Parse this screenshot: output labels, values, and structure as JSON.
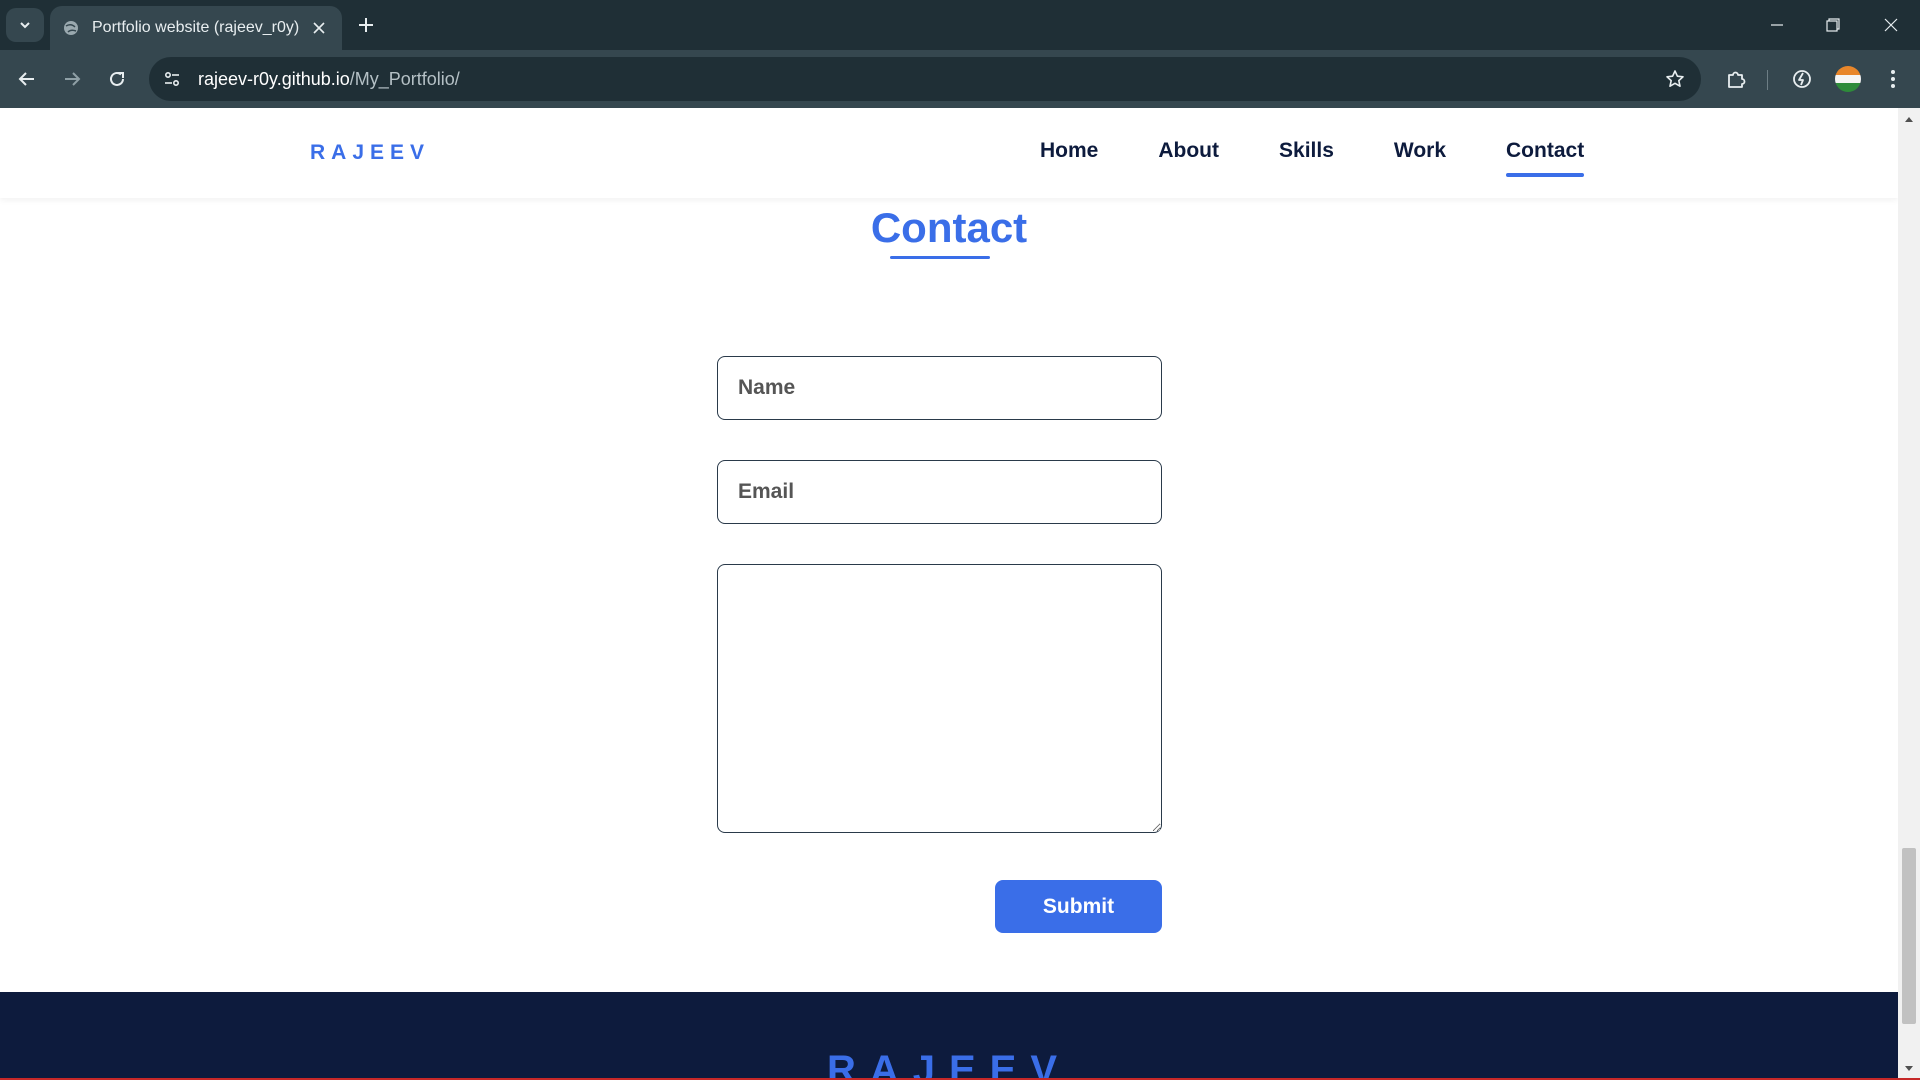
{
  "browser": {
    "tab": {
      "title": "Portfolio website (rajeev_r0y)"
    },
    "address": {
      "host": "rajeev-r0y.github.io",
      "path": "/My_Portfolio/"
    }
  },
  "site": {
    "logo": "RAJEEV",
    "nav": {
      "items": [
        {
          "label": "Home"
        },
        {
          "label": "About"
        },
        {
          "label": "Skills"
        },
        {
          "label": "Work"
        },
        {
          "label": "Contact",
          "active": true
        }
      ]
    },
    "contact": {
      "title": "Contact",
      "name_placeholder": "Name",
      "email_placeholder": "Email",
      "message_placeholder": "",
      "submit_label": "Submit"
    },
    "footer": {
      "logo": "RAJEEV"
    }
  },
  "colors": {
    "accent": "#3a6ee8",
    "nav_text": "#0d1b3d",
    "footer_bg": "#0d1b3d",
    "chrome_dark": "#1f2f36",
    "chrome_toolbar": "#35474f"
  }
}
